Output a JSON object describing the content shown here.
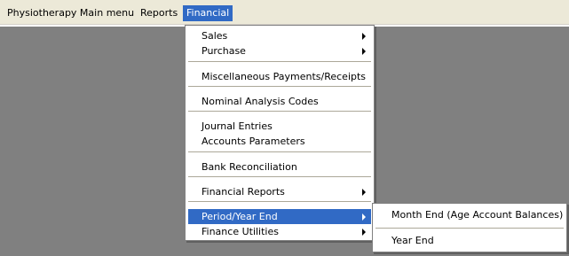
{
  "menubar": {
    "items": [
      {
        "label": "Physiotherapy Main menu"
      },
      {
        "label": "Reports"
      },
      {
        "label": "Financial"
      }
    ]
  },
  "financial_menu": {
    "items": [
      {
        "label": "Sales",
        "submenu": true
      },
      {
        "label": "Purchase",
        "submenu": true
      },
      {
        "label": "Miscellaneous Payments/Receipts"
      },
      {
        "label": "Nominal Analysis Codes"
      },
      {
        "label": "Journal Entries"
      },
      {
        "label": "Accounts Parameters"
      },
      {
        "label": "Bank Reconciliation"
      },
      {
        "label": "Financial Reports",
        "submenu": true
      },
      {
        "label": "Period/Year End",
        "submenu": true,
        "highlighted": true
      },
      {
        "label": "Finance Utilities",
        "submenu": true
      }
    ]
  },
  "period_submenu": {
    "items": [
      {
        "label": "Month End (Age Account Balances)"
      },
      {
        "label": "Year End"
      }
    ]
  },
  "colors": {
    "desktop": "#808080",
    "menubar": "#ece9d8",
    "highlight": "#316ac5"
  }
}
